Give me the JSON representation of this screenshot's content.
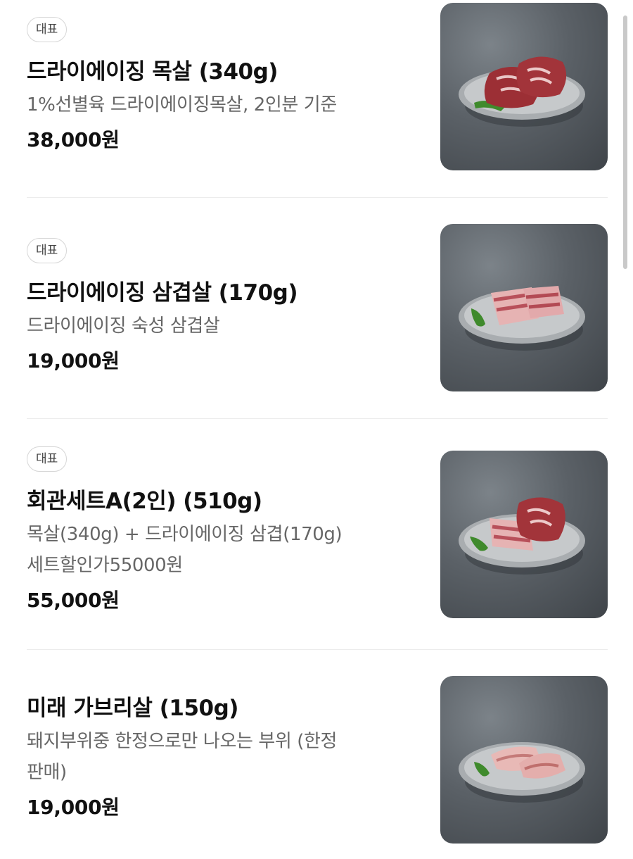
{
  "menu": {
    "items": [
      {
        "badge": "대표",
        "name": "드라이에이징 목살 (340g)",
        "desc": [
          "1%선별육 드라이에이징목살, 2인분 기준"
        ],
        "price": "38,000원",
        "image": "pork-neck-steaks-on-plate"
      },
      {
        "badge": "대표",
        "name": "드라이에이징 삼겹살 (170g)",
        "desc": [
          "드라이에이징 숙성 삼겹살"
        ],
        "price": "19,000원",
        "image": "pork-belly-on-plate"
      },
      {
        "badge": "대표",
        "name": "회관세트A(2인) (510g)",
        "desc": [
          "목살(340g) + 드라이에이징 삼겹(170g)",
          "세트할인가55000원"
        ],
        "price": "55,000원",
        "image": "pork-set-on-plate"
      },
      {
        "badge": "",
        "name": "미래 가브리살 (150g)",
        "desc": [
          "돼지부위중 한정으로만 나오는 부위 (한정",
          "판매)"
        ],
        "price": "19,000원",
        "image": "pork-jowl-on-plate"
      }
    ]
  }
}
